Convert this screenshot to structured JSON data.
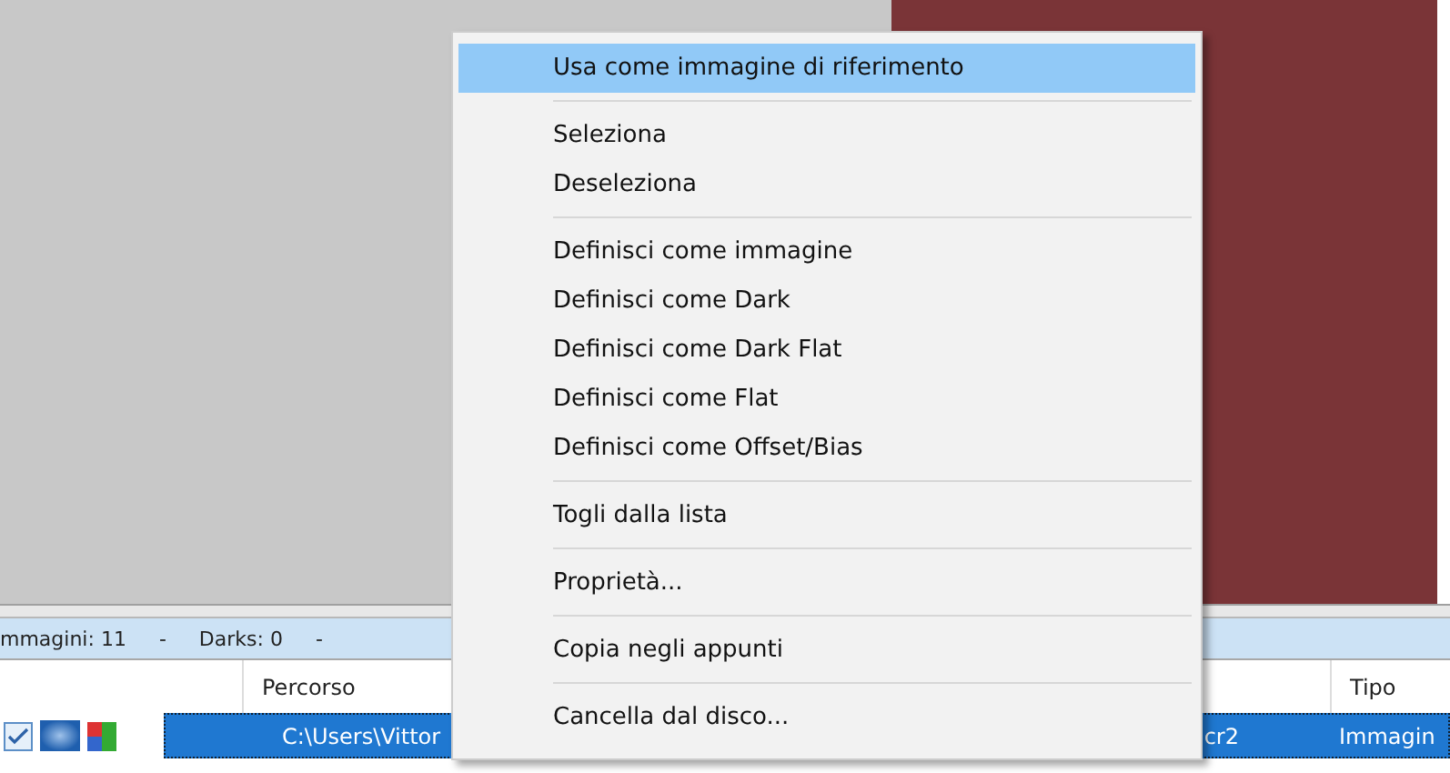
{
  "status_bar": {
    "items": [
      "mmagini: 11",
      "-",
      "Darks: 0",
      "-"
    ]
  },
  "table": {
    "columns": [
      "Percorso",
      "Tipo"
    ],
    "rows": [
      {
        "selected": true,
        "checked": true,
        "path_start": "C:\\Users\\Vittor",
        "path_end": "cr2",
        "type": "Immagin"
      }
    ]
  },
  "context_menu": {
    "groups": [
      [
        {
          "label": "Usa come immagine di riferimento",
          "selected": true
        }
      ],
      [
        {
          "label": "Seleziona",
          "selected": false
        },
        {
          "label": "Deseleziona",
          "selected": false
        }
      ],
      [
        {
          "label": "Definisci come immagine",
          "selected": false
        },
        {
          "label": "Definisci come Dark",
          "selected": false
        },
        {
          "label": "Definisci come Dark Flat",
          "selected": false
        },
        {
          "label": "Definisci come Flat",
          "selected": false
        },
        {
          "label": "Definisci come Offset/Bias",
          "selected": false
        }
      ],
      [
        {
          "label": "Togli dalla lista",
          "selected": false
        }
      ],
      [
        {
          "label": "Proprietà...",
          "selected": false
        }
      ],
      [
        {
          "label": "Copia negli appunti",
          "selected": false
        }
      ],
      [
        {
          "label": "Cancella dal disco...",
          "selected": false
        }
      ]
    ]
  }
}
